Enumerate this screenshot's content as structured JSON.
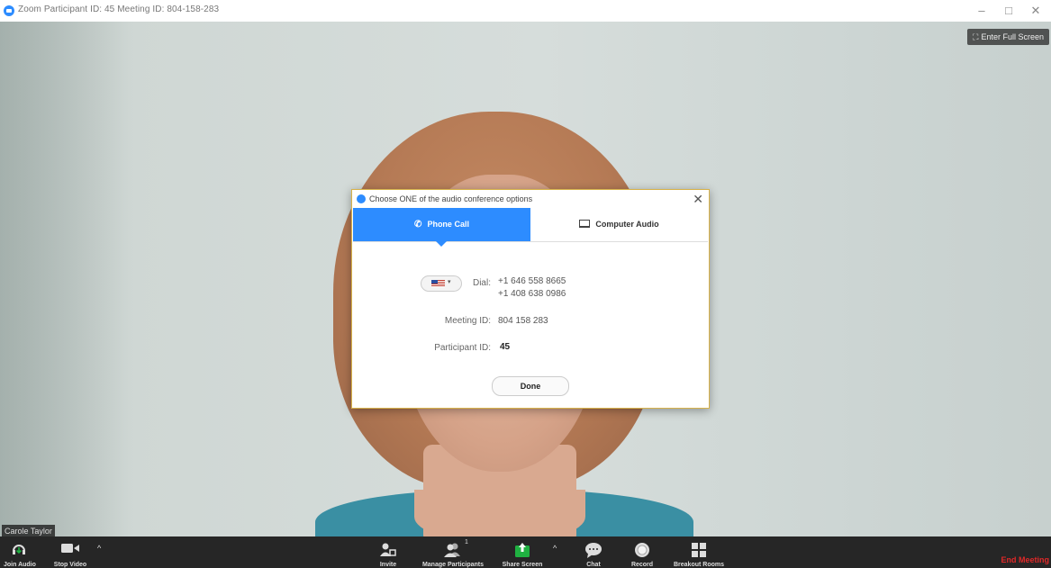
{
  "window": {
    "title": "Zoom Participant ID: 45   Meeting ID: 804-158-283",
    "minimize": "–",
    "restore": "□",
    "close": "✕"
  },
  "video": {
    "fullscreen_label": "Enter Full Screen",
    "participant_name": "Carole Taylor"
  },
  "dialog": {
    "title": "Choose ONE of the audio conference options",
    "close": "✕",
    "tabs": [
      {
        "label": "Phone Call",
        "active": true
      },
      {
        "label": "Computer Audio",
        "active": false
      }
    ],
    "dial_label": "Dial:",
    "dial_numbers": [
      "+1 646 558 8665",
      "+1 408 638 0986"
    ],
    "meeting_id_label": "Meeting ID:",
    "meeting_id": "804 158 283",
    "participant_id_label": "Participant ID:",
    "participant_id": "45",
    "done_label": "Done"
  },
  "toolbar": {
    "join_audio": "Join Audio",
    "stop_video": "Stop Video",
    "invite": "Invite",
    "manage_participants": "Manage Participants",
    "participants_count": "1",
    "share_screen": "Share Screen",
    "chat": "Chat",
    "record": "Record",
    "breakout_rooms": "Breakout Rooms",
    "end_meeting": "End Meeting",
    "caret": "^"
  },
  "colors": {
    "accent": "#2d8cff",
    "toolbar_bg": "#262626",
    "share_green": "#1fb141",
    "end_red": "#e02828"
  }
}
